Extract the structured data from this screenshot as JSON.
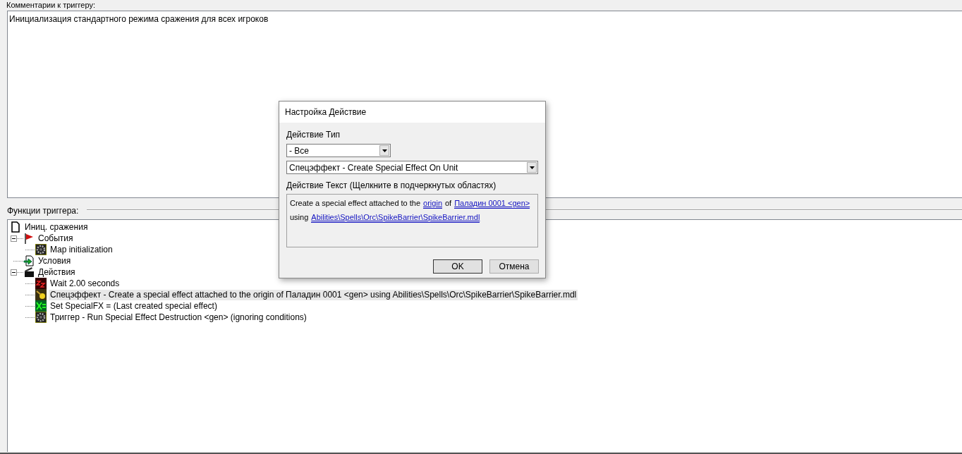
{
  "comment_section": {
    "label": "Комментарии к триггеру:",
    "value": "Инициализация стандартного режима сражения для всех игроков"
  },
  "functions_section": {
    "label": "Функции триггера:",
    "tree": [
      {
        "label": "Иниц. сражения",
        "kind": "trigger",
        "selected": false,
        "children": [
          {
            "label": "События",
            "kind": "events",
            "selected": false,
            "expanded": true,
            "children": [
              {
                "label": "Map initialization",
                "kind": "gear",
                "selected": false
              }
            ]
          },
          {
            "label": "Условия",
            "kind": "conditions",
            "selected": false
          },
          {
            "label": "Действия",
            "kind": "actions",
            "selected": false,
            "expanded": true,
            "children": [
              {
                "label": "Wait 2.00 seconds",
                "kind": "wait",
                "selected": false
              },
              {
                "label": "Спецэффект - Create a special effect attached to the origin of Паладин 0001 <gen> using Abilities\\Spells\\Orc\\SpikeBarrier\\SpikeBarrier.mdl",
                "kind": "effect",
                "selected": true
              },
              {
                "label": "Set SpecialFX = (Last created special effect)",
                "kind": "set",
                "selected": false
              },
              {
                "label": "Триггер - Run Special Effect Destruction <gen> (ignoring conditions)",
                "kind": "gear",
                "selected": false
              }
            ]
          }
        ]
      }
    ]
  },
  "dialog": {
    "title": "Настройка Действие",
    "type_label": "Действие Тип",
    "category_value": "- Все",
    "action_value": "Спецэффект - Create Special Effect On Unit",
    "text_label": "Действие Текст (Щелкните в подчеркнутых областях)",
    "text_parts": [
      {
        "kind": "plain",
        "text": "Create a special effect attached to the"
      },
      {
        "kind": "link",
        "text": "origin"
      },
      {
        "kind": "plain",
        "text": "of"
      },
      {
        "kind": "link",
        "text": "Паладин 0001 <gen>"
      },
      {
        "kind": "break"
      },
      {
        "kind": "plain",
        "text": "using"
      },
      {
        "kind": "link",
        "text": "Abilities\\Spells\\Orc\\SpikeBarrier\\SpikeBarrier.mdl"
      }
    ],
    "buttons": [
      "OK",
      "Отмена"
    ]
  }
}
